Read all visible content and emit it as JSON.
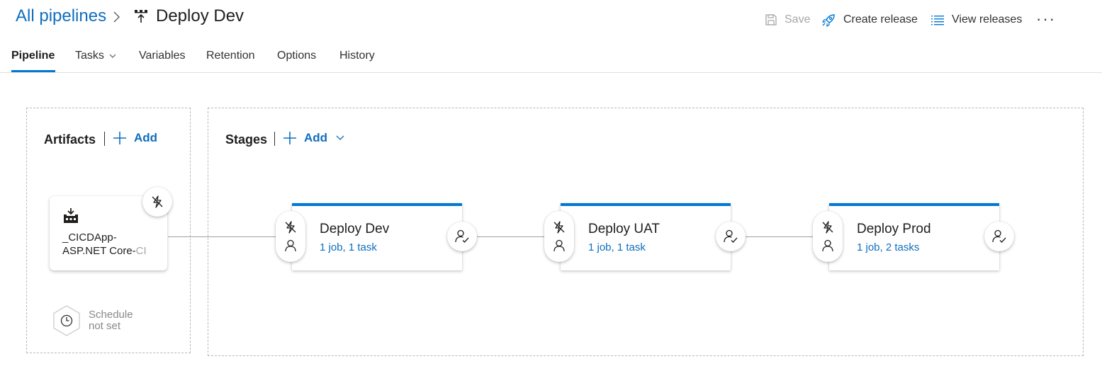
{
  "header": {
    "breadcrumb_root": "All pipelines",
    "title": "Deploy Dev",
    "toolbar": {
      "save": "Save",
      "create_release": "Create release",
      "view_releases": "View releases",
      "more": "···"
    }
  },
  "tabs": [
    {
      "label": "Pipeline",
      "active": true
    },
    {
      "label": "Tasks",
      "has_dropdown": true
    },
    {
      "label": "Variables"
    },
    {
      "label": "Retention"
    },
    {
      "label": "Options"
    },
    {
      "label": "History"
    }
  ],
  "artifacts": {
    "title": "Artifacts",
    "add_label": "Add",
    "items": [
      {
        "name_line1": "_CICDApp-",
        "name_line2": "ASP.NET Core-",
        "name_fade": "CI"
      }
    ],
    "schedule": {
      "line1": "Schedule",
      "line2": "not set"
    }
  },
  "stages": {
    "title": "Stages",
    "add_label": "Add",
    "items": [
      {
        "name": "Deploy Dev",
        "summary": "1 job, 1 task"
      },
      {
        "name": "Deploy UAT",
        "summary": "1 job, 1 task"
      },
      {
        "name": "Deploy Prod",
        "summary": "1 job, 2 tasks"
      }
    ]
  },
  "colors": {
    "accent": "#0078d4",
    "link": "#106ebe",
    "disabled": "#a6a6a6",
    "text": "#201f1e"
  }
}
